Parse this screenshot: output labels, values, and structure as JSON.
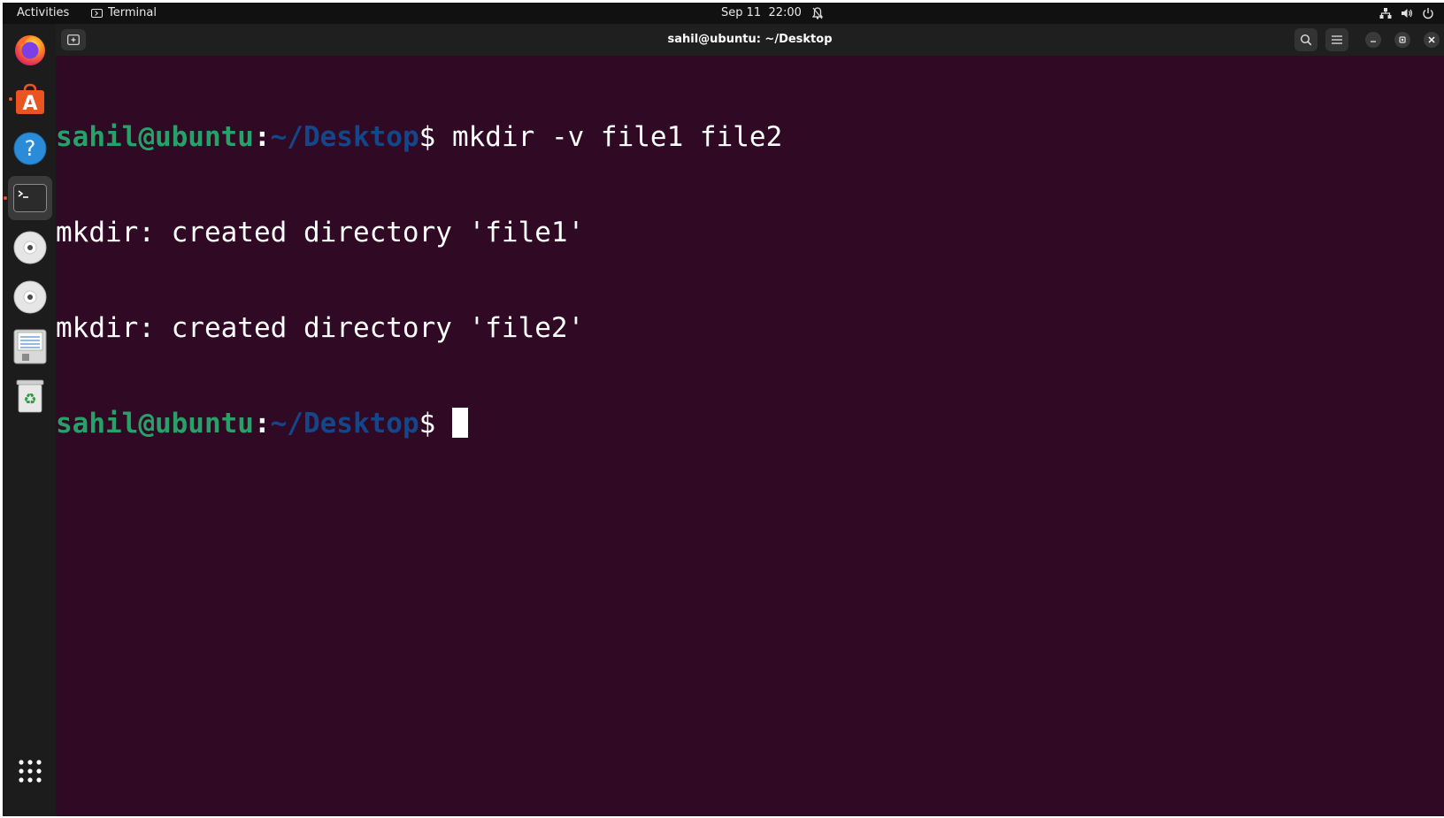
{
  "topbar": {
    "activities_label": "Activities",
    "app_name": "Terminal",
    "date": "Sep 11",
    "time": "22:00"
  },
  "dock": {
    "items": [
      {
        "name": "Firefox",
        "icon": "firefox-icon",
        "running": false
      },
      {
        "name": "Ubuntu Software",
        "icon": "software-store-icon",
        "running": true
      },
      {
        "name": "Help",
        "icon": "help-icon",
        "running": false
      },
      {
        "name": "Terminal",
        "icon": "terminal-icon",
        "running": true,
        "active": true
      },
      {
        "name": "Disc",
        "icon": "cd-drive-icon",
        "running": false
      },
      {
        "name": "Disc",
        "icon": "cd-drive-icon",
        "running": false
      },
      {
        "name": "Disk",
        "icon": "floppy-disk-icon",
        "running": false
      },
      {
        "name": "Trash",
        "icon": "trash-icon",
        "running": false
      }
    ],
    "show_apps_icon": "app-grid-icon"
  },
  "window": {
    "title": "sahil@ubuntu: ~/Desktop"
  },
  "terminal": {
    "prompt_user": "sahil@ubuntu",
    "prompt_sep": ":",
    "prompt_path": "~/Desktop",
    "prompt_dollar": "$",
    "command": " mkdir -v file1 file2",
    "output": [
      "mkdir: created directory 'file1'",
      "mkdir: created directory 'file2'"
    ]
  },
  "colors": {
    "terminal_bg": "#300a24",
    "prompt_user": "#26a269",
    "prompt_path": "#12488b",
    "accent": "#e95420"
  }
}
